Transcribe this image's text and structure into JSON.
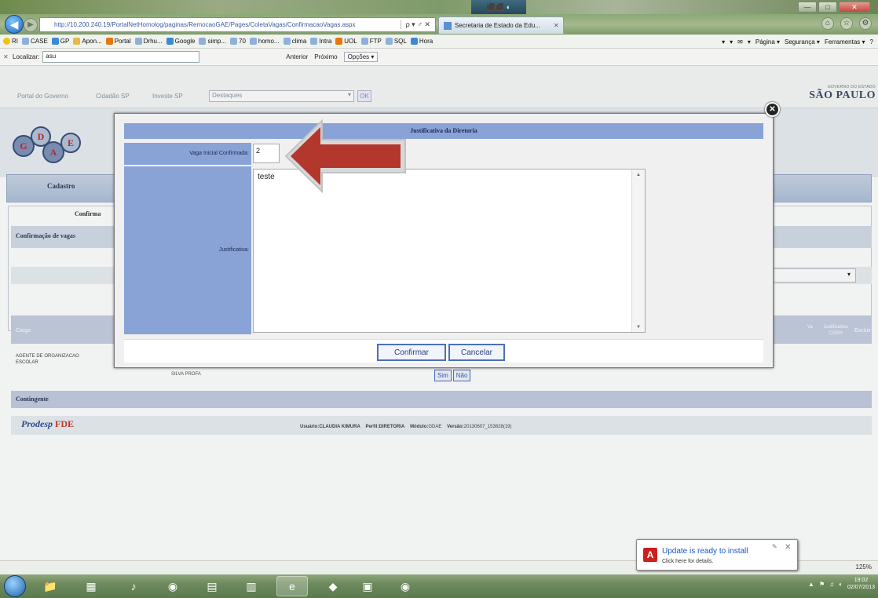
{
  "browser": {
    "url": "http://10.200.240.19/PortalNetHomolog/paginas/RemocaoGAE/Pages/ColetaVagas/ConfirmacaoVagas.aspx",
    "address_icons": "ρ ▾ ♂ ✕",
    "tab_title": "Secretaria de Estado da Edu...",
    "tab_close": "✕",
    "back": "◀",
    "forward": "▶",
    "window_center": "⬛⬛ ◐",
    "win_min": "—",
    "win_max": "□",
    "win_close": "✕",
    "nav_right": [
      "⌂",
      "☆",
      "⚙"
    ]
  },
  "favorites": {
    "items": [
      "RI",
      "CASE",
      "GP",
      "Apon...",
      "Portal",
      "Drhu...",
      "Google",
      "simp...",
      "70",
      "homo...",
      "clima",
      "Intra",
      "UOL",
      "FTP",
      "SQL",
      "Hora"
    ],
    "tools": [
      "▾",
      "▾",
      "✉",
      "▾",
      "Página ▾",
      "Segurança ▾",
      "Ferramentas ▾",
      "?"
    ]
  },
  "findbar": {
    "close": "✕",
    "label": "Localizar:",
    "value": "asu",
    "prev": "Anterior",
    "next": "Próximo",
    "options": "Opções ▾"
  },
  "portal": {
    "links": [
      "Portal do Governo",
      "Cidadão SP",
      "Investe SP"
    ],
    "destaques": "Destaques",
    "select_arrow": "▾",
    "ok": "OK",
    "gov_small": "GOVERNO DO ESTADO",
    "gov_big": "SÃO PAULO"
  },
  "sdae": {
    "logo_letters": [
      "G",
      "D",
      "A",
      "E"
    ],
    "menu": "Cadastro",
    "tab": "Confirma",
    "section": "Confirmação de vagas",
    "select_arrow": "▾"
  },
  "table": {
    "headers": {
      "cargo": "Cargo",
      "just": "Justificativa CGRH",
      "excluir": "Excluir",
      "v": "Va"
    },
    "row": {
      "cargo": "AGENTE DE ORGANIZACAO ESCOLAR",
      "school": "SILVA PROFA"
    },
    "sim": "Sim",
    "nao": "Não"
  },
  "contingente": "Contingente",
  "footer": {
    "logo1": "Prodesp",
    "logo2": "FDE",
    "usuario_label": "Usuário:",
    "usuario": "CLAUDIA KIMURA",
    "perfil_label": "Perfil:",
    "perfil": "DIRETORIA",
    "modulo_label": "Módulo:",
    "modulo": "GDAE",
    "versao_label": "Versão:",
    "versao": "20130607_153828(19)"
  },
  "dialog": {
    "close": "✕",
    "title": "Justificativa da Diretoria",
    "vaga_label": "Vaga Inicial Confirmada:",
    "vaga_value": "2",
    "just_label": "Justificativa:",
    "just_value": "teste",
    "scroll_up": "▲",
    "scroll_down": "▼",
    "confirmar": "Confirmar",
    "cancelar": "Cancelar"
  },
  "status": {
    "zoom": "125%"
  },
  "taskbar": {
    "apps": [
      "📁",
      "▦",
      "♪",
      "◉",
      "▤",
      "▥",
      "e",
      "◆",
      "▣",
      "◉"
    ],
    "tray_icons": [
      "▲",
      "⚑",
      "♫",
      "◐"
    ],
    "time": "19:02",
    "date": "02/07/2013"
  },
  "toast": {
    "icon": "A",
    "title": "Update is ready to install",
    "subtitle": "Click here for details.",
    "close": "✕",
    "pin": "✎"
  },
  "colors": {
    "dialog_label_bg": "#8aa3d7",
    "arrow_red": "#b3372d",
    "button_border": "#4b6fbd"
  }
}
